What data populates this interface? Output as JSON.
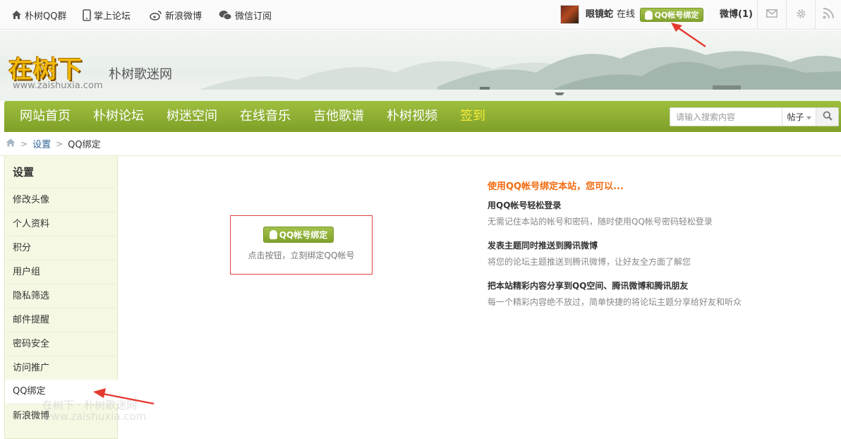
{
  "topbar": {
    "links": [
      {
        "label": "朴树QQ群",
        "icon": "home-icon"
      },
      {
        "label": "掌上论坛",
        "icon": "mobile-icon"
      },
      {
        "label": "新浪微博",
        "icon": "weibo-icon"
      },
      {
        "label": "微信订阅",
        "icon": "wechat-icon"
      }
    ],
    "username": "眼镜蛇",
    "status": "在线",
    "qq_bind_label": "QQ帐号绑定",
    "weibo_label": "微博(1)",
    "icons": [
      "mail-icon",
      "gear-icon",
      "rss-icon"
    ]
  },
  "banner": {
    "logo_text": "在树下",
    "logo_sub": "朴树歌迷网",
    "logo_url": "www.zaishuxia.com"
  },
  "nav": {
    "items": [
      {
        "label": "网站首页"
      },
      {
        "label": "朴树论坛"
      },
      {
        "label": "树迷空间"
      },
      {
        "label": "在线音乐"
      },
      {
        "label": "吉他歌谱"
      },
      {
        "label": "朴树视频"
      },
      {
        "label": "签到"
      }
    ],
    "search_placeholder": "请输入搜索内容",
    "search_type": "帖子"
  },
  "breadcrumb": {
    "items": [
      "设置",
      "QQ绑定"
    ]
  },
  "sidebar": {
    "title": "设置",
    "items": [
      {
        "label": "修改头像"
      },
      {
        "label": "个人资料"
      },
      {
        "label": "积分"
      },
      {
        "label": "用户组"
      },
      {
        "label": "隐私筛选"
      },
      {
        "label": "邮件提醒"
      },
      {
        "label": "密码安全"
      },
      {
        "label": "访问推广"
      },
      {
        "label": "QQ绑定"
      },
      {
        "label": "新浪微博"
      }
    ],
    "active_index": 8
  },
  "main": {
    "bind_button": "QQ帐号绑定",
    "bind_hint": "点击按钮，立刻绑定QQ帐号",
    "info_title": "使用QQ帐号绑定本站，您可以...",
    "features": [
      {
        "title": "用QQ帐号轻松登录",
        "desc": "无需记住本站的帐号和密码，随时使用QQ帐号密码轻松登录"
      },
      {
        "title": "发表主题同时推送到腾讯微博",
        "desc": "将您的论坛主题推送到腾讯微博，让好友全方面了解您"
      },
      {
        "title": "把本站精彩内容分享到QQ空间、腾讯微博和腾讯朋友",
        "desc": "每一个精彩内容绝不放过，简单快捷的将论坛主题分享给好友和听众"
      }
    ]
  },
  "watermark": {
    "line1": "在树下 · 朴树歌迷网",
    "line2": "www.zaishuxia.com"
  },
  "colors": {
    "nav_green": "#8fb035",
    "accent_orange": "#f26c11",
    "sidebar_bg": "#f5f8e3",
    "arrow_red": "#e53a2f"
  }
}
